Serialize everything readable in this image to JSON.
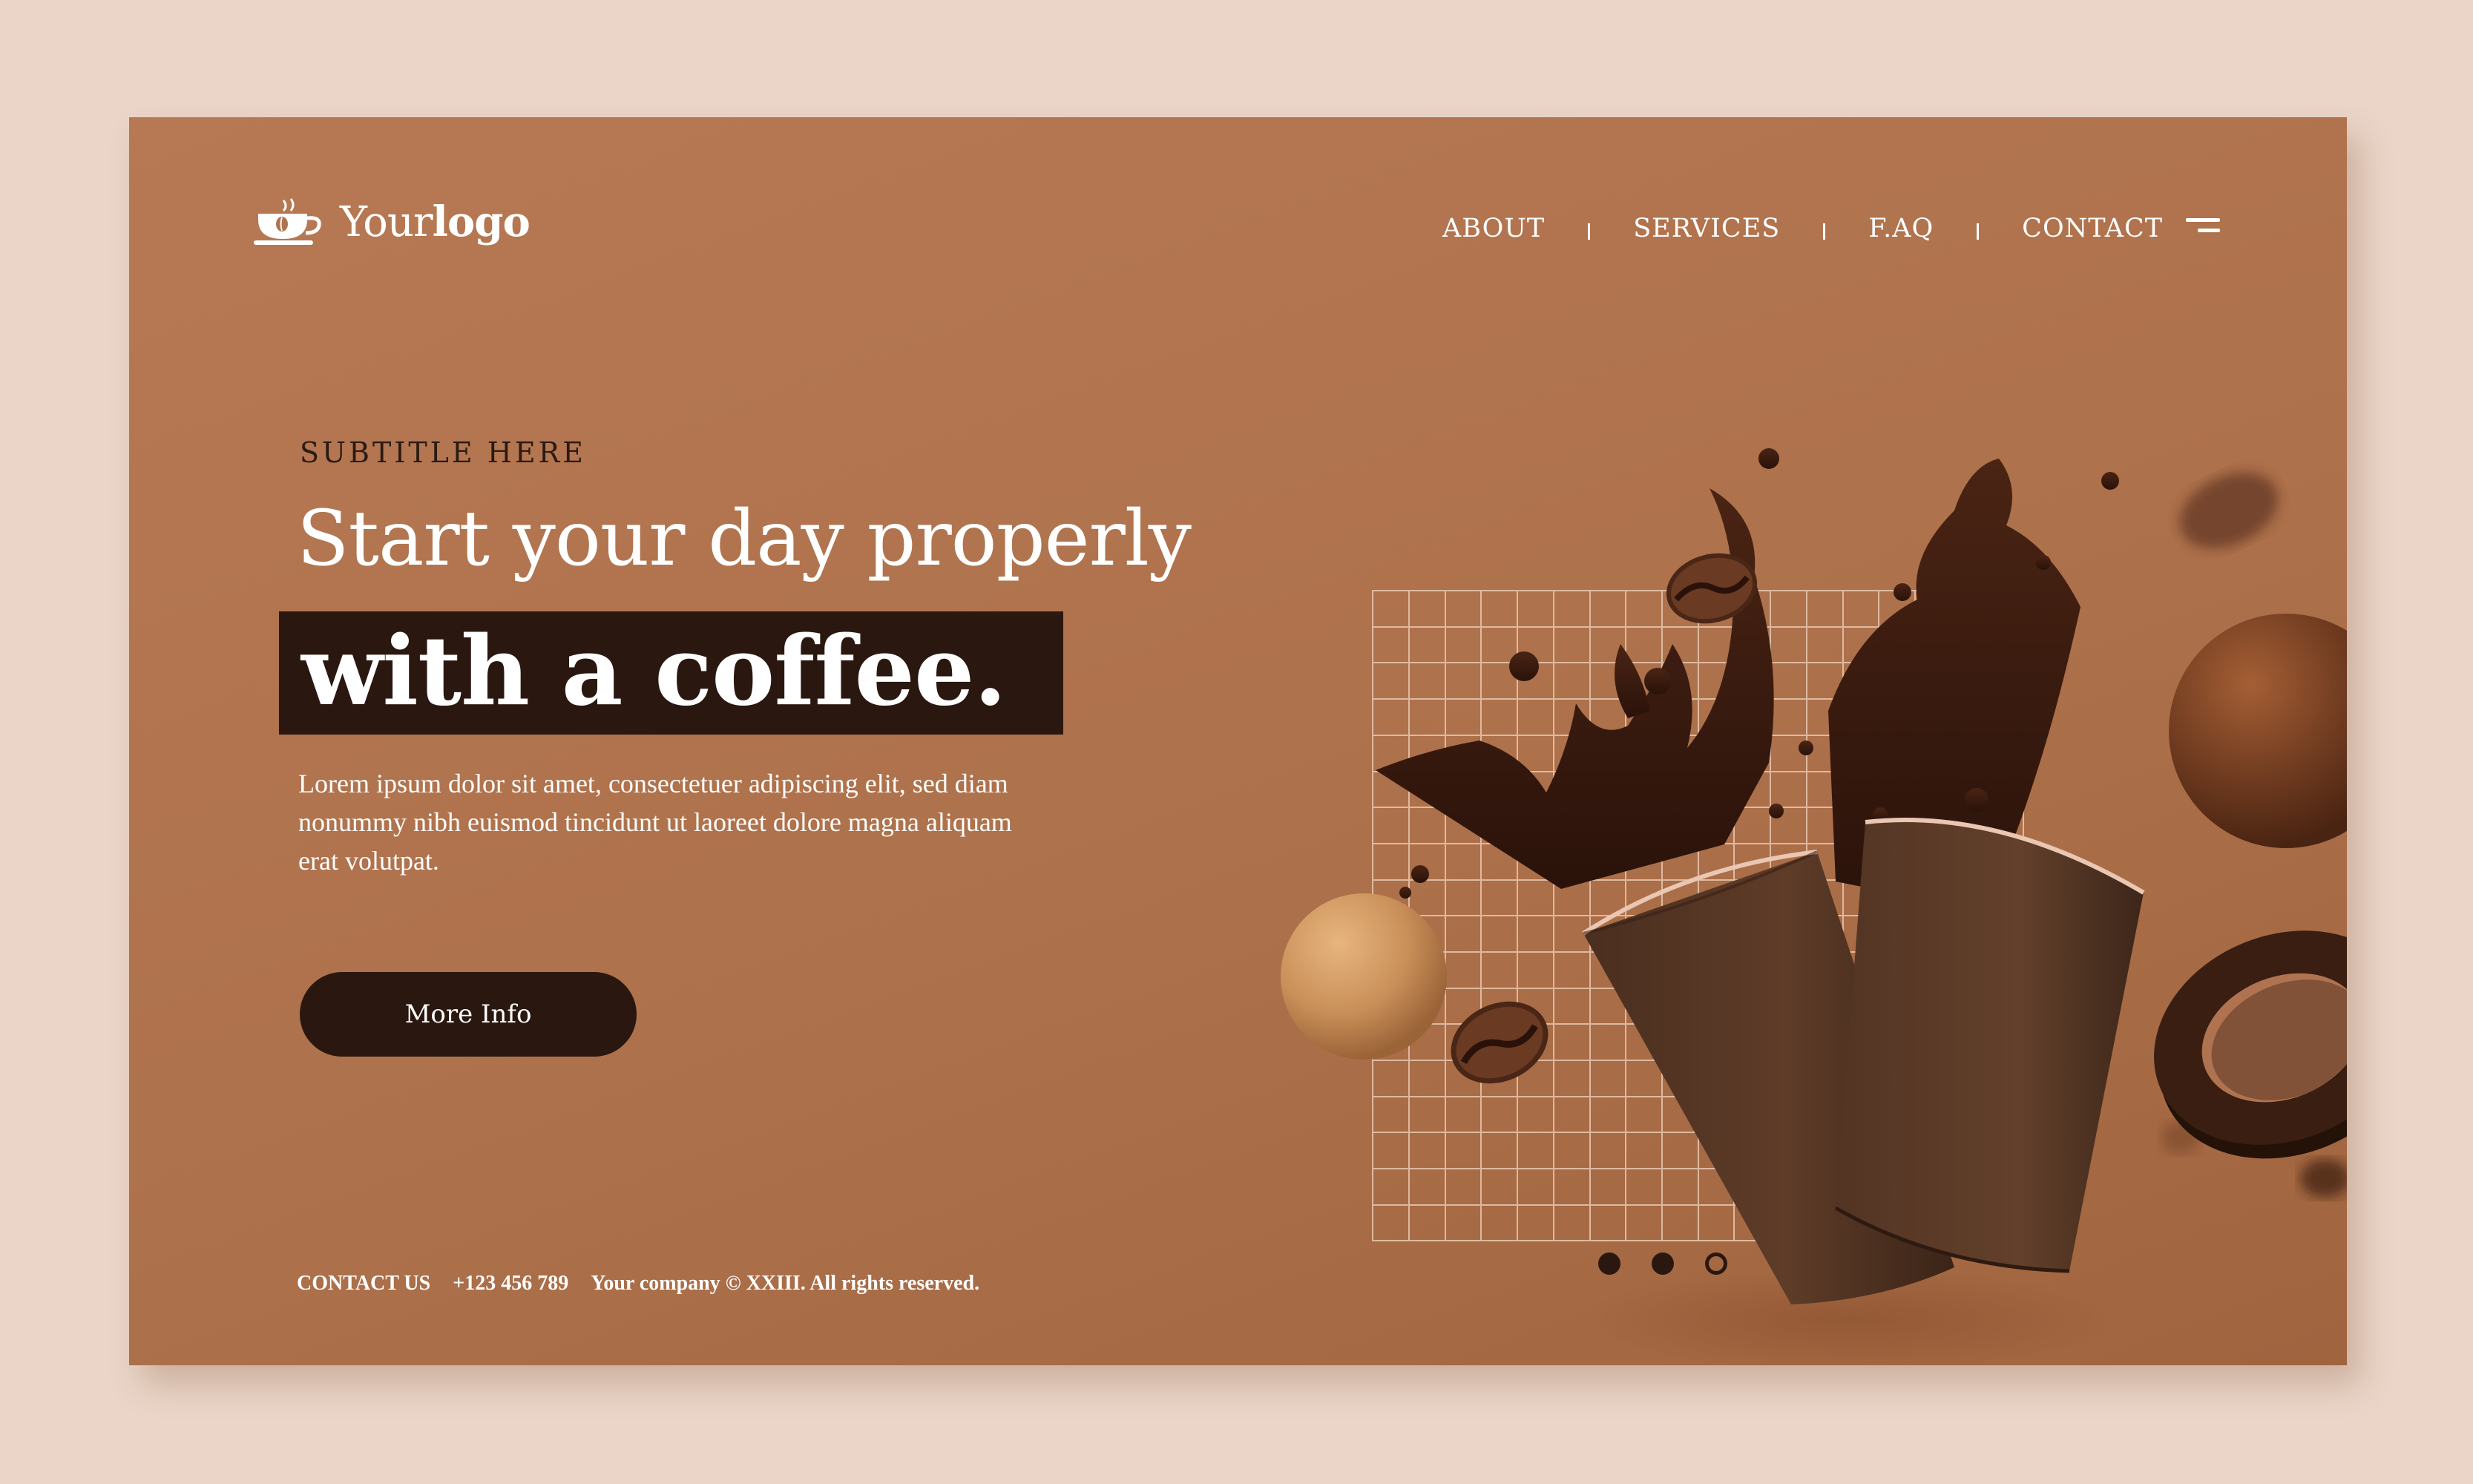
{
  "brand": {
    "logo_icon": "coffee-cup-icon",
    "logo_regular": "Your",
    "logo_bold": "logo"
  },
  "nav": {
    "items": [
      {
        "label": "ABOUT"
      },
      {
        "label": "SERVICES"
      },
      {
        "label": "F.AQ"
      },
      {
        "label": "CONTACT"
      }
    ],
    "menu_icon": "hamburger-menu-icon"
  },
  "hero": {
    "subtitle": "SUBTITLE HERE",
    "headline": "Start your day properly",
    "highlight": "with a coffee.",
    "body": "Lorem ipsum dolor sit amet, consectetuer adipiscing elit, sed diam nonummy nibh euismod tincidunt ut laoreet dolore magna aliquam erat volutpat.",
    "cta_label": "More Info"
  },
  "footer": {
    "contact_label": "CONTACT US",
    "phone": "+123 456 789",
    "copyright": "Your company © XXIII. All rights reserved."
  },
  "slider": {
    "count": 3,
    "active_slide": 3
  },
  "colors": {
    "page_bg": "#ead5c8",
    "card_bg": "#b07350",
    "dark_brown": "#2a1810",
    "text_light": "#ffffff"
  }
}
